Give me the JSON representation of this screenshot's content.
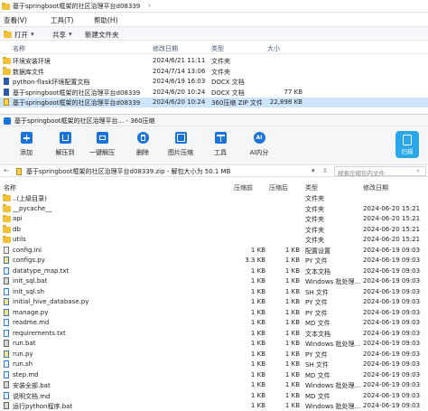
{
  "explorer": {
    "address": [
      "基于springboot框架的社区治理平台d08339",
      "›"
    ],
    "menu": [
      "查看(V)",
      "工具(T)",
      "帮助(H)"
    ],
    "toolbar": {
      "open": "打开",
      "share": "共享",
      "new_folder": "新建文件夹"
    },
    "columns": {
      "name": "名称",
      "modified": "修改日期",
      "type": "类型",
      "size": "大小"
    },
    "rows": [
      {
        "name": "环境安装环境",
        "modified": "2024/6/21 11:11",
        "type": "文件夹",
        "size": "",
        "icon": "folder-icon"
      },
      {
        "name": "数据库文件",
        "modified": "2024/7/14 13:06",
        "type": "文件夹",
        "size": "",
        "icon": "folder-icon"
      },
      {
        "name": "python-flask环境配置文档",
        "modified": "2024/6/19 16:03",
        "type": "DOCX 文档",
        "size": "",
        "icon": "word-doc-icon"
      },
      {
        "name": "基于springboot框架的社区治理平台d08339",
        "modified": "2024/6/20 10:24",
        "type": "DOCX 文档",
        "size": "77 KB",
        "icon": "word-doc-icon"
      },
      {
        "name": "基于springboot框架的社区治理平台d08339",
        "modified": "2024/6/20 10:24",
        "type": "360压缩 ZIP 文件",
        "size": "22,898 KB",
        "icon": "zip-archive-icon",
        "selected": true
      }
    ]
  },
  "zip": {
    "title": "基于springboot框架的社区治理平台... - 360压缩",
    "toolbar": [
      "添加",
      "解压到",
      "一键解压",
      "删除",
      "图片压缩",
      "工具",
      "AI内分"
    ],
    "scan_label": "扫描",
    "path": "基于springboot框架的社区治理平台d08339.zip - 解包大小为 50.1 MB",
    "search_placeholder": "搜索压缩包内文件",
    "columns": {
      "name": "名称",
      "compressed": "压缩前",
      "after": "压缩后",
      "type": "类型",
      "modified": "修改日期"
    },
    "rows": [
      {
        "name": "..(上级目录)",
        "compressed": "",
        "after": "",
        "type": "文件夹",
        "modified": "",
        "icon": "folder-icon"
      },
      {
        "name": "__pycache__",
        "compressed": "",
        "after": "",
        "type": "文件夹",
        "modified": "2024-06-20 15:21",
        "icon": "folder-icon"
      },
      {
        "name": "api",
        "compressed": "",
        "after": "",
        "type": "文件夹",
        "modified": "2024-06-20 15:21",
        "icon": "folder-icon"
      },
      {
        "name": "db",
        "compressed": "",
        "after": "",
        "type": "文件夹",
        "modified": "2024-06-20 15:21",
        "icon": "folder-icon"
      },
      {
        "name": "utils",
        "compressed": "",
        "after": "",
        "type": "文件夹",
        "modified": "2024-06-20 15:21",
        "icon": "folder-icon"
      },
      {
        "name": "config.ini",
        "compressed": "1 KB",
        "after": "1 KB",
        "type": "配置设置",
        "modified": "2024-06-19 09:03",
        "icon": "ini-file-icon"
      },
      {
        "name": "configs.py",
        "compressed": "3.3 KB",
        "after": "1 KB",
        "type": "PY 文件",
        "modified": "2024-06-19 09:03",
        "icon": "py-file-icon"
      },
      {
        "name": "datatype_map.txt",
        "compressed": "1 KB",
        "after": "1 KB",
        "type": "文本文档",
        "modified": "2024-06-19 09:03",
        "icon": "txt-file-icon"
      },
      {
        "name": "init_sql.bat",
        "compressed": "1 KB",
        "after": "1 KB",
        "type": "Windows 批处理...",
        "modified": "2024-06-19 09:03",
        "icon": "bat-file-icon"
      },
      {
        "name": "init_sql.sh",
        "compressed": "1 KB",
        "after": "1 KB",
        "type": "SH 文件",
        "modified": "2024-06-19 09:03",
        "icon": "sh-file-icon"
      },
      {
        "name": "initial_hive_database.py",
        "compressed": "1 KB",
        "after": "1 KB",
        "type": "PY 文件",
        "modified": "2024-06-19 09:03",
        "icon": "py-file-icon"
      },
      {
        "name": "manage.py",
        "compressed": "1 KB",
        "after": "1 KB",
        "type": "PY 文件",
        "modified": "2024-06-19 09:03",
        "icon": "py-file-icon"
      },
      {
        "name": "readme.md",
        "compressed": "1 KB",
        "after": "1 KB",
        "type": "MD 文件",
        "modified": "2024-06-19 09:03",
        "icon": "md-file-icon"
      },
      {
        "name": "requirements.txt",
        "compressed": "1 KB",
        "after": "1 KB",
        "type": "文本文档",
        "modified": "2024-06-19 09:03",
        "icon": "txt-file-icon"
      },
      {
        "name": "run.bat",
        "compressed": "1 KB",
        "after": "1 KB",
        "type": "Windows 批处理...",
        "modified": "2024-06-19 09:03",
        "icon": "bat-file-icon"
      },
      {
        "name": "run.py",
        "compressed": "1 KB",
        "after": "1 KB",
        "type": "PY 文件",
        "modified": "2024-06-19 09:03",
        "icon": "py-file-icon"
      },
      {
        "name": "run.sh",
        "compressed": "1 KB",
        "after": "1 KB",
        "type": "SH 文件",
        "modified": "2024-06-19 09:03",
        "icon": "sh-file-icon"
      },
      {
        "name": "step.md",
        "compressed": "1 KB",
        "after": "1 KB",
        "type": "MD 文件",
        "modified": "2024-06-19 09:03",
        "icon": "md-file-icon"
      },
      {
        "name": "安装全部.bat",
        "compressed": "1 KB",
        "after": "1 KB",
        "type": "Windows 批处理...",
        "modified": "2024-06-19 09:03",
        "icon": "bat-file-icon"
      },
      {
        "name": "说明文档.md",
        "compressed": "1 KB",
        "after": "1 KB",
        "type": "MD 文件",
        "modified": "2024-06-19 09:03",
        "icon": "md-file-icon"
      },
      {
        "name": "运行python程序.bat",
        "compressed": "1 KB",
        "after": "1 KB",
        "type": "Windows 批处理...",
        "modified": "2024-06-19 09:03",
        "icon": "bat-file-icon"
      }
    ]
  },
  "colors": {
    "accent": "#1a73d9",
    "selection": "#cde5fb",
    "folder": "#f2c23a",
    "toolbar_bg": "#f4f6f8"
  }
}
